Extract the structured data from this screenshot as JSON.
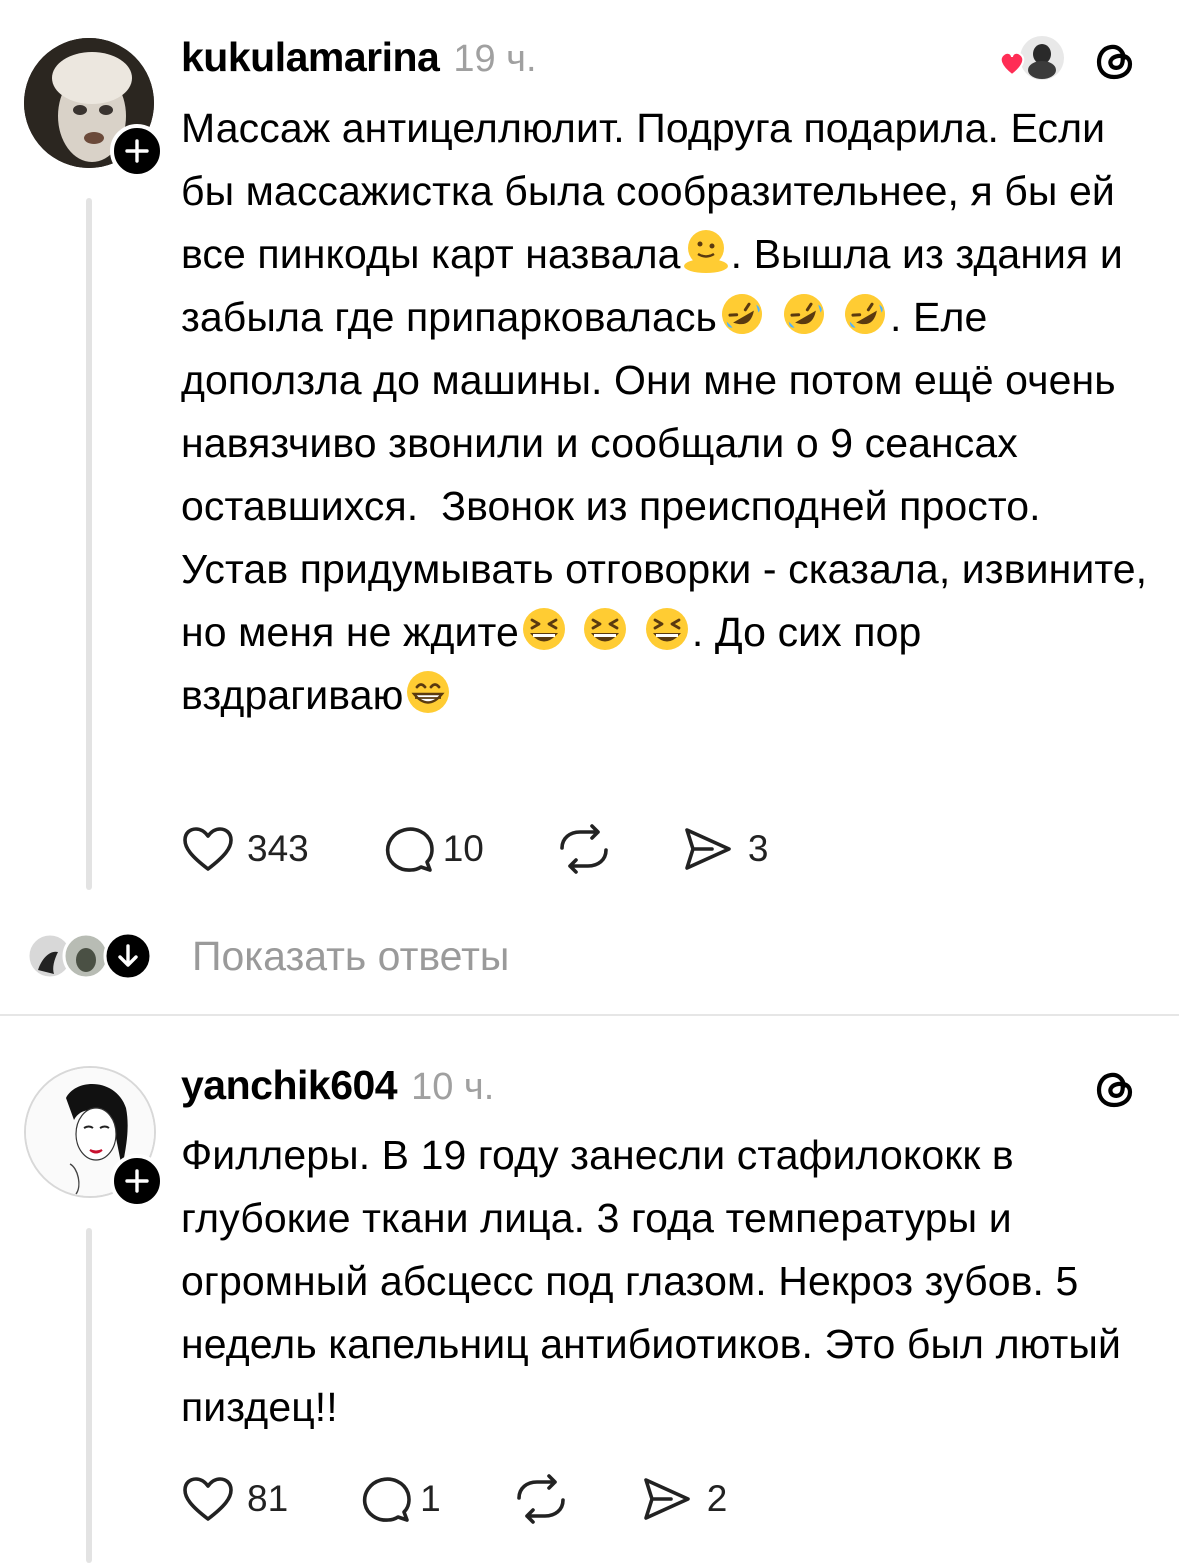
{
  "posts": [
    {
      "username": "kukulamarina",
      "time": "19 ч.",
      "text_parts": [
        "Массаж антицеллюлит. Подруга подарила. Если бы массажистка была сообразительнее, я бы ей все пинкоды карт назвала",
        ". Вышла из здания и забыла где припарковалась",
        ". Еле доползла до машины. Они мне потом ещё очень навязчиво звонили и сообщали о 9 сеансах оставшихся.  Звонок из преисподней просто. Устав придумывать отговорки - сказала, извините, но меня не ждите",
        ". До сих пор вздрагиваю"
      ],
      "likes": "343",
      "comments": "10",
      "shares": "3",
      "liked_by_icon": "heart-with-avatar-icon"
    },
    {
      "username": "yanchik604",
      "time": "10 ч.",
      "text": "Филлеры. В 19 году занесли стафилококк в глубокие ткани лица. 3 года температуры и огромный абсцесс под глазом. Некроз зубов. 5 недель капельниц антибиотиков. Это был лютый пиздец!!",
      "likes": "81",
      "comments": "1",
      "shares": "2"
    }
  ],
  "replies": {
    "label": "Показать ответы"
  },
  "icons": {
    "like": "heart-icon",
    "comment": "speech-bubble-icon",
    "repost": "repost-icon",
    "share": "send-icon",
    "threads": "threads-logo-icon",
    "follow": "plus-icon"
  },
  "colors": {
    "accent_heart": "#ff2d55",
    "muted_text": "#9a9a9a",
    "thread_line": "#e3e3e3"
  }
}
